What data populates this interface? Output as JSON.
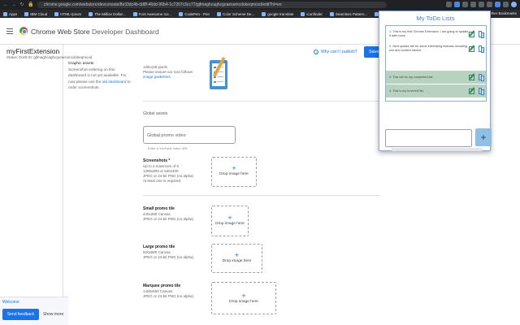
{
  "browser": {
    "url": "chrome.google.com/webstore/devconsole/8e33dc4b-dd8f-46dd-90b4-1c7207c3cc77/gjfmaghcaghcgoaesomcdokeqmcod/edit?hl=en",
    "bookmarks": [
      {
        "label": "Apps"
      },
      {
        "label": "IBM Cloud"
      },
      {
        "label": "HTML-Ipsum"
      },
      {
        "label": "The Million Dollar..."
      },
      {
        "label": "Font Awesome Ico..."
      },
      {
        "label": "CodePen - Pen"
      },
      {
        "label": "Color Scheme De..."
      },
      {
        "label": "google translate"
      },
      {
        "label": "iconfinder"
      },
      {
        "label": "Seamless Pattern..."
      },
      {
        "label": "css box mod"
      }
    ],
    "other_bookmarks": "Other Bookmarks"
  },
  "header": {
    "title": "Chrome Web Store",
    "subtitle": "Developer Dashboard"
  },
  "item": {
    "title": "myFirstExtension",
    "status": "Status: Draft    ID: gjfmaghcaghcgoaesomcdokeqmcod",
    "why_link": "Why can't I publish?",
    "save_label": "Save"
  },
  "left_help": {
    "heading": "Graphic assets",
    "text_1": "Screenshot ordering on this dashboard is not yet available. For now please use the",
    "link": "old dashboard",
    "text_2": "to order screenshots."
  },
  "store_icon": {
    "size": "128x128 pixels",
    "desc": "Please ensure our icon follows",
    "link": "image guidelines"
  },
  "global_assets": {
    "title": "Global assets",
    "promo_placeholder": "Global promo video",
    "promo_hint": "Enter a YouTube video URL"
  },
  "screenshots": {
    "title": "Screenshots *",
    "line1": "Up to a maximum of 5",
    "line2": "1280x800 or 640x400",
    "line3": "JPEG or 24-bit PNG (no alpha)",
    "line4": "At least one is required",
    "drop": "Drop image here"
  },
  "small_promo": {
    "title": "Small promo tile",
    "line1": "440x280 Canvas",
    "line2": "JPEG or 24-bit PNG (no alpha)",
    "drop": "Drop image here"
  },
  "large_promo": {
    "title": "Large promo tile",
    "line1": "920x680 Canvas",
    "line2": "JPEG or 24-bit PNG (no alpha)",
    "drop": "Drop image here"
  },
  "marquee_promo": {
    "title": "Marquee promo tile",
    "line1": "1400x560 Canvas",
    "line2": "JPEG or 24-bit PNG (no alpha)",
    "drop": "Drop image here"
  },
  "bottom": {
    "welcome": "Welcome",
    "feedback": "Send feedback",
    "show_more": "Show more"
  },
  "popup": {
    "title": "My ToDo Lists",
    "todos": [
      {
        "text": "1.  This is my first Chrome Extension. I am going to update it later more.",
        "done": false
      },
      {
        "text": "2.  Next update will be some interesting features including urls and context menus",
        "done": false
      },
      {
        "text": "3.  This will be my completed list.",
        "done": true
      },
      {
        "text": "4.  This is my hovered list.",
        "done": true
      }
    ],
    "add_label": "+",
    "colors": {
      "accent": "#3d7ed8",
      "done_bg": "#b9d1c0",
      "add_btn": "#8fc0e4"
    }
  }
}
